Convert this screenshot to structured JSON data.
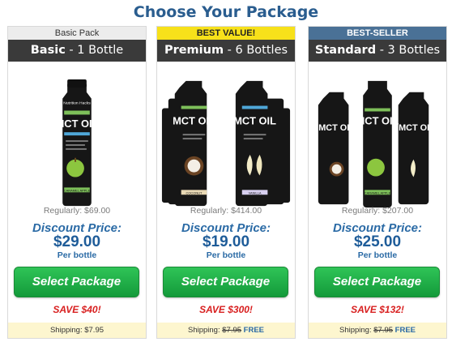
{
  "header": {
    "title": "Choose Your Package"
  },
  "packages": [
    {
      "badge": "Basic Pack",
      "name": "Basic",
      "qty": "1 Bottle",
      "regular": "Regularly: $69.00",
      "discount_label": "Discount Price:",
      "price": "$29.00",
      "per": "Per bottle",
      "button": "Select Package",
      "save": "SAVE $40!",
      "shipping_label": "Shipping:",
      "shipping_price": "$7.95",
      "shipping_free": ""
    },
    {
      "badge": "BEST VALUE!",
      "name": "Premium",
      "qty": "6 Bottles",
      "regular": "Regularly: $414.00",
      "discount_label": "Discount Price:",
      "price": "$19.00",
      "per": "Per bottle",
      "button": "Select Package",
      "save": "SAVE $300!",
      "shipping_label": "Shipping:",
      "shipping_price": "$7.95",
      "shipping_free": "FREE"
    },
    {
      "badge": "BEST-SELLER",
      "name": "Standard",
      "qty": "3 Bottles",
      "regular": "Regularly: $207.00",
      "discount_label": "Discount Price:",
      "price": "$25.00",
      "per": "Per bottle",
      "button": "Select Package",
      "save": "SAVE $132!",
      "shipping_label": "Shipping:",
      "shipping_price": "$7.95",
      "shipping_free": "FREE"
    }
  ],
  "product": {
    "bottle_title": "MCT OIL",
    "brand": "Nutrition Hacks",
    "top_tag": "100% PURE ORGANIC",
    "flavors": [
      "CARAMEL APPLE",
      "COCONUT",
      "VANILLA",
      "CARAMEL APPLE"
    ]
  },
  "colors": {
    "accent": "#2a5d8f",
    "button": "#1fa846",
    "save": "#d81f1f",
    "best_value": "#f7e11a",
    "best_seller": "#4a7196"
  }
}
